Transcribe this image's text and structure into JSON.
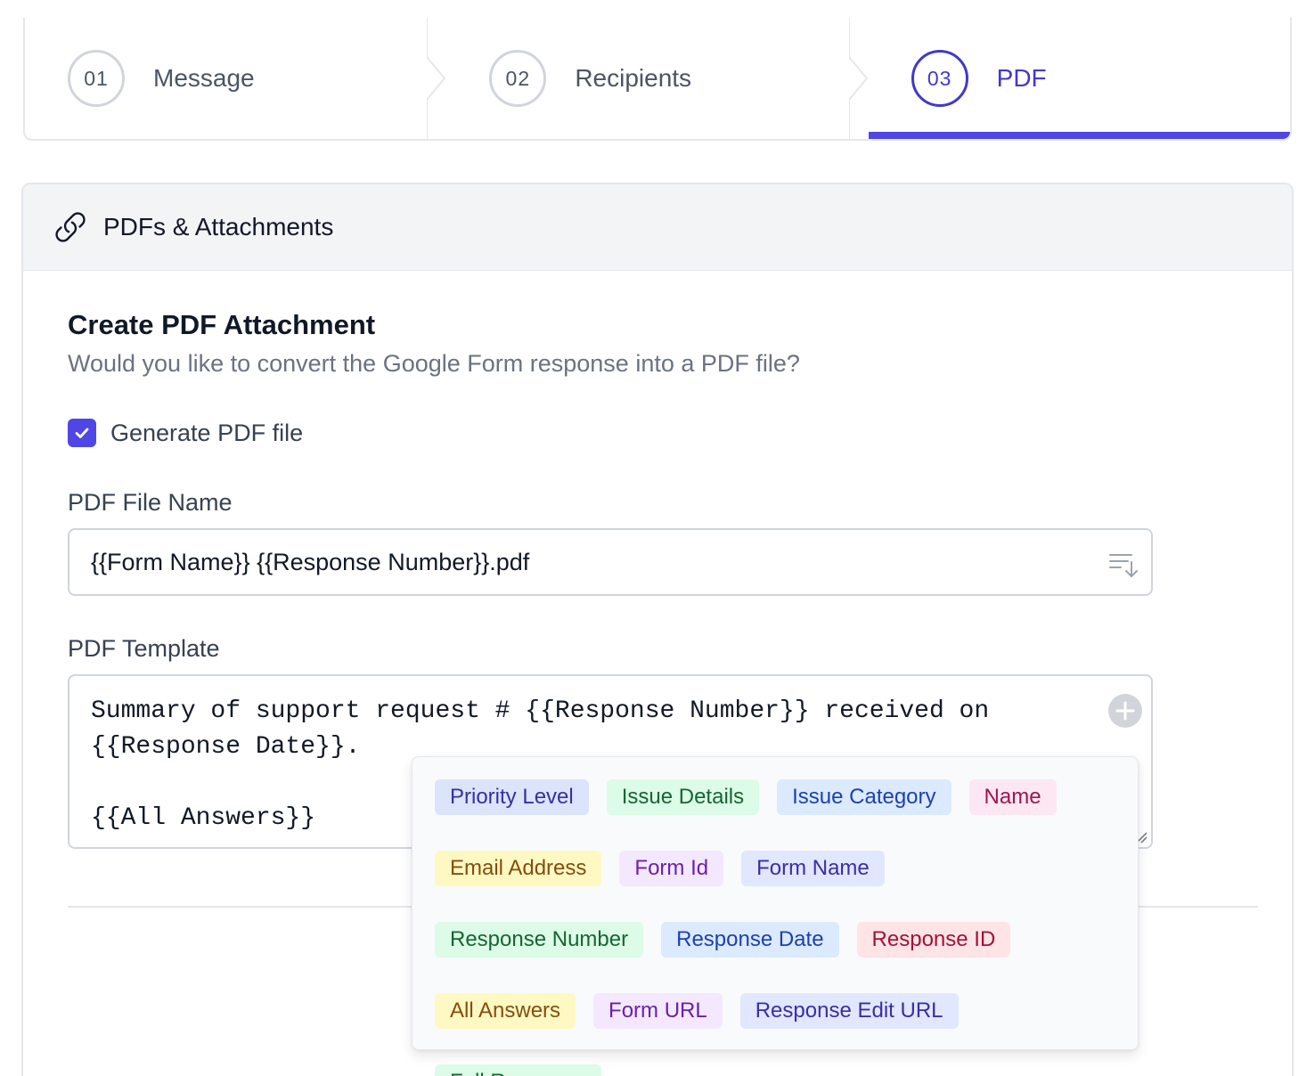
{
  "stepper": {
    "steps": [
      {
        "number": "01",
        "label": "Message",
        "active": false
      },
      {
        "number": "02",
        "label": "Recipients",
        "active": false
      },
      {
        "number": "03",
        "label": "PDF",
        "active": true
      }
    ],
    "accent_color": "#4f46e5"
  },
  "card": {
    "header_title": "PDFs & Attachments",
    "header_icon": "link-icon",
    "section_title": "Create PDF Attachment",
    "section_description": "Would you like to convert the Google Form response into a PDF file?",
    "generate_pdf": {
      "label": "Generate PDF file",
      "checked": true
    },
    "file_name": {
      "label": "PDF File Name",
      "value": "{{Form Name}} {{Response Number}}.pdf"
    },
    "template": {
      "label": "PDF Template",
      "line1": "Summary of support request # {{Response Number}} received on",
      "line2": "{{Response Date}}.",
      "line3": "{{All Answers}}"
    }
  },
  "placeholders": {
    "tags": [
      {
        "label": "Priority Level",
        "color": "blue"
      },
      {
        "label": "Issue Details",
        "color": "green"
      },
      {
        "label": "Issue Category",
        "color": "sky"
      },
      {
        "label": "Name",
        "color": "pink"
      },
      {
        "label": "Email Address",
        "color": "yellow"
      },
      {
        "label": "Form Id",
        "color": "purple"
      },
      {
        "label": "Form Name",
        "color": "indigo"
      },
      {
        "label": "Response Number",
        "color": "green"
      },
      {
        "label": "Response Date",
        "color": "sky"
      },
      {
        "label": "Response ID",
        "color": "rose"
      },
      {
        "label": "All Answers",
        "color": "yellow"
      },
      {
        "label": "Form URL",
        "color": "purple"
      },
      {
        "label": "Response Edit URL",
        "color": "indigo"
      },
      {
        "label": "Full Response",
        "color": "green"
      }
    ]
  }
}
